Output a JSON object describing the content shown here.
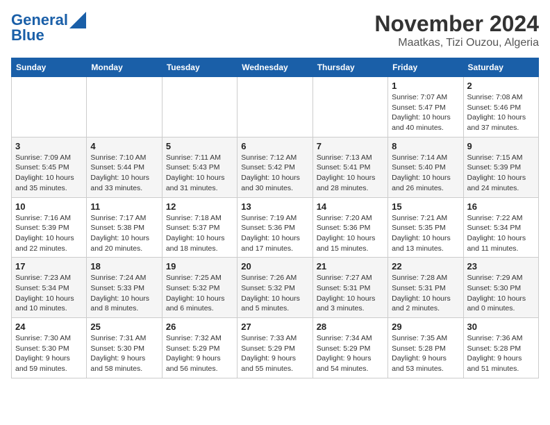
{
  "logo": {
    "line1": "General",
    "line2": "Blue"
  },
  "title": "November 2024",
  "subtitle": "Maatkas, Tizi Ouzou, Algeria",
  "weekdays": [
    "Sunday",
    "Monday",
    "Tuesday",
    "Wednesday",
    "Thursday",
    "Friday",
    "Saturday"
  ],
  "weeks": [
    [
      {
        "day": "",
        "info": ""
      },
      {
        "day": "",
        "info": ""
      },
      {
        "day": "",
        "info": ""
      },
      {
        "day": "",
        "info": ""
      },
      {
        "day": "",
        "info": ""
      },
      {
        "day": "1",
        "info": "Sunrise: 7:07 AM\nSunset: 5:47 PM\nDaylight: 10 hours and 40 minutes."
      },
      {
        "day": "2",
        "info": "Sunrise: 7:08 AM\nSunset: 5:46 PM\nDaylight: 10 hours and 37 minutes."
      }
    ],
    [
      {
        "day": "3",
        "info": "Sunrise: 7:09 AM\nSunset: 5:45 PM\nDaylight: 10 hours and 35 minutes."
      },
      {
        "day": "4",
        "info": "Sunrise: 7:10 AM\nSunset: 5:44 PM\nDaylight: 10 hours and 33 minutes."
      },
      {
        "day": "5",
        "info": "Sunrise: 7:11 AM\nSunset: 5:43 PM\nDaylight: 10 hours and 31 minutes."
      },
      {
        "day": "6",
        "info": "Sunrise: 7:12 AM\nSunset: 5:42 PM\nDaylight: 10 hours and 30 minutes."
      },
      {
        "day": "7",
        "info": "Sunrise: 7:13 AM\nSunset: 5:41 PM\nDaylight: 10 hours and 28 minutes."
      },
      {
        "day": "8",
        "info": "Sunrise: 7:14 AM\nSunset: 5:40 PM\nDaylight: 10 hours and 26 minutes."
      },
      {
        "day": "9",
        "info": "Sunrise: 7:15 AM\nSunset: 5:39 PM\nDaylight: 10 hours and 24 minutes."
      }
    ],
    [
      {
        "day": "10",
        "info": "Sunrise: 7:16 AM\nSunset: 5:39 PM\nDaylight: 10 hours and 22 minutes."
      },
      {
        "day": "11",
        "info": "Sunrise: 7:17 AM\nSunset: 5:38 PM\nDaylight: 10 hours and 20 minutes."
      },
      {
        "day": "12",
        "info": "Sunrise: 7:18 AM\nSunset: 5:37 PM\nDaylight: 10 hours and 18 minutes."
      },
      {
        "day": "13",
        "info": "Sunrise: 7:19 AM\nSunset: 5:36 PM\nDaylight: 10 hours and 17 minutes."
      },
      {
        "day": "14",
        "info": "Sunrise: 7:20 AM\nSunset: 5:36 PM\nDaylight: 10 hours and 15 minutes."
      },
      {
        "day": "15",
        "info": "Sunrise: 7:21 AM\nSunset: 5:35 PM\nDaylight: 10 hours and 13 minutes."
      },
      {
        "day": "16",
        "info": "Sunrise: 7:22 AM\nSunset: 5:34 PM\nDaylight: 10 hours and 11 minutes."
      }
    ],
    [
      {
        "day": "17",
        "info": "Sunrise: 7:23 AM\nSunset: 5:34 PM\nDaylight: 10 hours and 10 minutes."
      },
      {
        "day": "18",
        "info": "Sunrise: 7:24 AM\nSunset: 5:33 PM\nDaylight: 10 hours and 8 minutes."
      },
      {
        "day": "19",
        "info": "Sunrise: 7:25 AM\nSunset: 5:32 PM\nDaylight: 10 hours and 6 minutes."
      },
      {
        "day": "20",
        "info": "Sunrise: 7:26 AM\nSunset: 5:32 PM\nDaylight: 10 hours and 5 minutes."
      },
      {
        "day": "21",
        "info": "Sunrise: 7:27 AM\nSunset: 5:31 PM\nDaylight: 10 hours and 3 minutes."
      },
      {
        "day": "22",
        "info": "Sunrise: 7:28 AM\nSunset: 5:31 PM\nDaylight: 10 hours and 2 minutes."
      },
      {
        "day": "23",
        "info": "Sunrise: 7:29 AM\nSunset: 5:30 PM\nDaylight: 10 hours and 0 minutes."
      }
    ],
    [
      {
        "day": "24",
        "info": "Sunrise: 7:30 AM\nSunset: 5:30 PM\nDaylight: 9 hours and 59 minutes."
      },
      {
        "day": "25",
        "info": "Sunrise: 7:31 AM\nSunset: 5:30 PM\nDaylight: 9 hours and 58 minutes."
      },
      {
        "day": "26",
        "info": "Sunrise: 7:32 AM\nSunset: 5:29 PM\nDaylight: 9 hours and 56 minutes."
      },
      {
        "day": "27",
        "info": "Sunrise: 7:33 AM\nSunset: 5:29 PM\nDaylight: 9 hours and 55 minutes."
      },
      {
        "day": "28",
        "info": "Sunrise: 7:34 AM\nSunset: 5:29 PM\nDaylight: 9 hours and 54 minutes."
      },
      {
        "day": "29",
        "info": "Sunrise: 7:35 AM\nSunset: 5:28 PM\nDaylight: 9 hours and 53 minutes."
      },
      {
        "day": "30",
        "info": "Sunrise: 7:36 AM\nSunset: 5:28 PM\nDaylight: 9 hours and 51 minutes."
      }
    ]
  ]
}
